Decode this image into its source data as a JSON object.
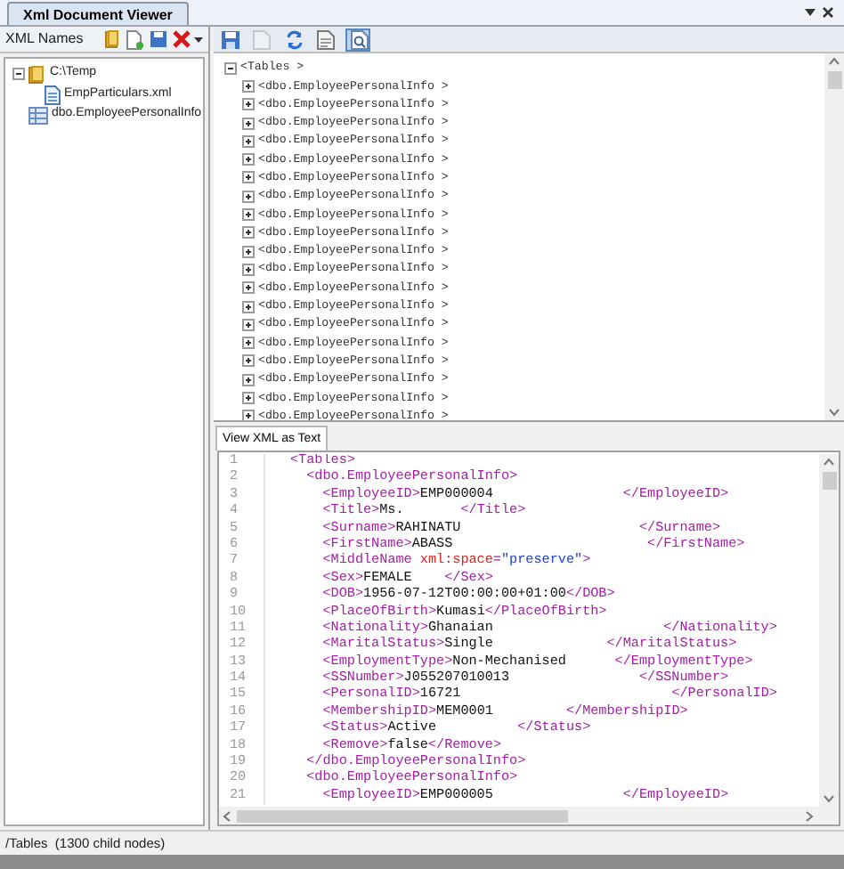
{
  "document_tab": {
    "title": "Xml Document Viewer",
    "selected": true
  },
  "names_panel": {
    "title": "XML Names",
    "tree": [
      {
        "label": "C:\\Temp",
        "kind": "folder",
        "expanded": true,
        "children": [
          {
            "label": "EmpParticulars.xml",
            "kind": "file"
          }
        ]
      },
      {
        "label": "dbo.EmployeePersonalInfo",
        "kind": "table"
      }
    ]
  },
  "view_toolbar": [
    {
      "kind": "save",
      "disabled": false,
      "pressed": false
    },
    {
      "kind": "page",
      "disabled": true,
      "pressed": false
    },
    {
      "kind": "refresh",
      "disabled": false,
      "pressed": false
    },
    {
      "kind": "document",
      "disabled": false,
      "pressed": false
    },
    {
      "kind": "find",
      "disabled": false,
      "pressed": true
    }
  ],
  "xml_tree": [
    {
      "label": "<Tables >",
      "expanded": true,
      "children": [
        {
          "label": "<dbo.EmployeePersonalInfo >",
          "expanded": false
        },
        {
          "label": "<dbo.EmployeePersonalInfo >",
          "expanded": false
        },
        {
          "label": "<dbo.EmployeePersonalInfo >",
          "expanded": false
        },
        {
          "label": "<dbo.EmployeePersonalInfo >",
          "expanded": false
        },
        {
          "label": "<dbo.EmployeePersonalInfo >",
          "expanded": false
        },
        {
          "label": "<dbo.EmployeePersonalInfo >",
          "expanded": false
        },
        {
          "label": "<dbo.EmployeePersonalInfo >",
          "expanded": false
        },
        {
          "label": "<dbo.EmployeePersonalInfo >",
          "expanded": false
        },
        {
          "label": "<dbo.EmployeePersonalInfo >",
          "expanded": false
        },
        {
          "label": "<dbo.EmployeePersonalInfo >",
          "expanded": false
        },
        {
          "label": "<dbo.EmployeePersonalInfo >",
          "expanded": false
        },
        {
          "label": "<dbo.EmployeePersonalInfo >",
          "expanded": false
        },
        {
          "label": "<dbo.EmployeePersonalInfo >",
          "expanded": false
        },
        {
          "label": "<dbo.EmployeePersonalInfo >",
          "expanded": false
        },
        {
          "label": "<dbo.EmployeePersonalInfo >",
          "expanded": false
        },
        {
          "label": "<dbo.EmployeePersonalInfo >",
          "expanded": false
        },
        {
          "label": "<dbo.EmployeePersonalInfo >",
          "expanded": false
        },
        {
          "label": "<dbo.EmployeePersonalInfo >",
          "expanded": false
        },
        {
          "label": "<dbo.EmployeePersonalInfo >",
          "expanded": false
        }
      ]
    }
  ],
  "text_view": {
    "tab": {
      "label": "View XML as Text",
      "selected": true
    },
    "lines": [
      {
        "number": "1",
        "segments": [
          {
            "kind": "tag",
            "text": "<Tables>"
          }
        ]
      },
      {
        "number": "2",
        "segments": [
          {
            "kind": "indent"
          },
          {
            "kind": "tag",
            "text": "<dbo.EmployeePersonalInfo>"
          }
        ]
      },
      {
        "number": "3",
        "segments": [
          {
            "kind": "indent"
          },
          {
            "kind": "indent"
          },
          {
            "kind": "tag",
            "text": "<EmployeeID>"
          },
          {
            "kind": "text",
            "text": "EMP000004                "
          },
          {
            "kind": "tag",
            "text": "</EmployeeID>"
          }
        ]
      },
      {
        "number": "4",
        "segments": [
          {
            "kind": "indent"
          },
          {
            "kind": "indent"
          },
          {
            "kind": "tag",
            "text": "<Title>"
          },
          {
            "kind": "text",
            "text": "Ms.       "
          },
          {
            "kind": "tag",
            "text": "</Title>"
          }
        ]
      },
      {
        "number": "5",
        "segments": [
          {
            "kind": "indent"
          },
          {
            "kind": "indent"
          },
          {
            "kind": "tag",
            "text": "<Surname>"
          },
          {
            "kind": "text",
            "text": "RAHINATU                      "
          },
          {
            "kind": "tag",
            "text": "</Surname>"
          }
        ]
      },
      {
        "number": "6",
        "segments": [
          {
            "kind": "indent"
          },
          {
            "kind": "indent"
          },
          {
            "kind": "tag",
            "text": "<FirstName>"
          },
          {
            "kind": "text",
            "text": "ABASS                        "
          },
          {
            "kind": "tag",
            "text": "</FirstName>"
          }
        ]
      },
      {
        "number": "7",
        "segments": [
          {
            "kind": "indent"
          },
          {
            "kind": "indent"
          },
          {
            "kind": "tag",
            "text": "<MiddleName "
          },
          {
            "kind": "attr",
            "text": "xml:space"
          },
          {
            "kind": "tag",
            "text": "="
          },
          {
            "kind": "value",
            "text": "\"preserve\""
          },
          {
            "kind": "tag",
            "text": ">"
          }
        ]
      },
      {
        "number": "8",
        "segments": [
          {
            "kind": "indent"
          },
          {
            "kind": "indent"
          },
          {
            "kind": "tag",
            "text": "<Sex>"
          },
          {
            "kind": "text",
            "text": "FEMALE    "
          },
          {
            "kind": "tag",
            "text": "</Sex>"
          }
        ]
      },
      {
        "number": "9",
        "segments": [
          {
            "kind": "indent"
          },
          {
            "kind": "indent"
          },
          {
            "kind": "tag",
            "text": "<DOB>"
          },
          {
            "kind": "text",
            "text": "1956-07-12T00:00:00+01:00"
          },
          {
            "kind": "tag",
            "text": "</DOB>"
          }
        ]
      },
      {
        "number": "10",
        "segments": [
          {
            "kind": "indent"
          },
          {
            "kind": "indent"
          },
          {
            "kind": "tag",
            "text": "<PlaceOfBirth>"
          },
          {
            "kind": "text",
            "text": "Kumasi"
          },
          {
            "kind": "tag",
            "text": "</PlaceOfBirth>"
          }
        ]
      },
      {
        "number": "11",
        "segments": [
          {
            "kind": "indent"
          },
          {
            "kind": "indent"
          },
          {
            "kind": "tag",
            "text": "<Nationality>"
          },
          {
            "kind": "text",
            "text": "Ghanaian                     "
          },
          {
            "kind": "tag",
            "text": "</Nationality>"
          }
        ]
      },
      {
        "number": "12",
        "segments": [
          {
            "kind": "indent"
          },
          {
            "kind": "indent"
          },
          {
            "kind": "tag",
            "text": "<MaritalStatus>"
          },
          {
            "kind": "text",
            "text": "Single              "
          },
          {
            "kind": "tag",
            "text": "</MaritalStatus>"
          }
        ]
      },
      {
        "number": "13",
        "segments": [
          {
            "kind": "indent"
          },
          {
            "kind": "indent"
          },
          {
            "kind": "tag",
            "text": "<EmploymentType>"
          },
          {
            "kind": "text",
            "text": "Non-Mechanised      "
          },
          {
            "kind": "tag",
            "text": "</EmploymentType>"
          }
        ]
      },
      {
        "number": "14",
        "segments": [
          {
            "kind": "indent"
          },
          {
            "kind": "indent"
          },
          {
            "kind": "tag",
            "text": "<SSNumber>"
          },
          {
            "kind": "text",
            "text": "J055207010013                "
          },
          {
            "kind": "tag",
            "text": "</SSNumber>"
          }
        ]
      },
      {
        "number": "15",
        "segments": [
          {
            "kind": "indent"
          },
          {
            "kind": "indent"
          },
          {
            "kind": "tag",
            "text": "<PersonalID>"
          },
          {
            "kind": "text",
            "text": "16721                          "
          },
          {
            "kind": "tag",
            "text": "</PersonalID>"
          }
        ]
      },
      {
        "number": "16",
        "segments": [
          {
            "kind": "indent"
          },
          {
            "kind": "indent"
          },
          {
            "kind": "tag",
            "text": "<MembershipID>"
          },
          {
            "kind": "text",
            "text": "MEM0001         "
          },
          {
            "kind": "tag",
            "text": "</MembershipID>"
          }
        ]
      },
      {
        "number": "17",
        "segments": [
          {
            "kind": "indent"
          },
          {
            "kind": "indent"
          },
          {
            "kind": "tag",
            "text": "<Status>"
          },
          {
            "kind": "text",
            "text": "Active          "
          },
          {
            "kind": "tag",
            "text": "</Status>"
          }
        ]
      },
      {
        "number": "18",
        "segments": [
          {
            "kind": "indent"
          },
          {
            "kind": "indent"
          },
          {
            "kind": "tag",
            "text": "<Remove>"
          },
          {
            "kind": "text",
            "text": "false"
          },
          {
            "kind": "tag",
            "text": "</Remove>"
          }
        ]
      },
      {
        "number": "19",
        "segments": [
          {
            "kind": "indent"
          },
          {
            "kind": "tag",
            "text": "</dbo.EmployeePersonalInfo>"
          }
        ]
      },
      {
        "number": "20",
        "segments": [
          {
            "kind": "indent"
          },
          {
            "kind": "tag",
            "text": "<dbo.EmployeePersonalInfo>"
          }
        ]
      },
      {
        "number": "21",
        "segments": [
          {
            "kind": "indent"
          },
          {
            "kind": "indent"
          },
          {
            "kind": "tag",
            "text": "<EmployeeID>"
          },
          {
            "kind": "text",
            "text": "EMP000005                "
          },
          {
            "kind": "tag",
            "text": "</EmployeeID>"
          }
        ]
      }
    ]
  },
  "status_bar": {
    "text": "/Tables  (1300 child nodes)"
  }
}
